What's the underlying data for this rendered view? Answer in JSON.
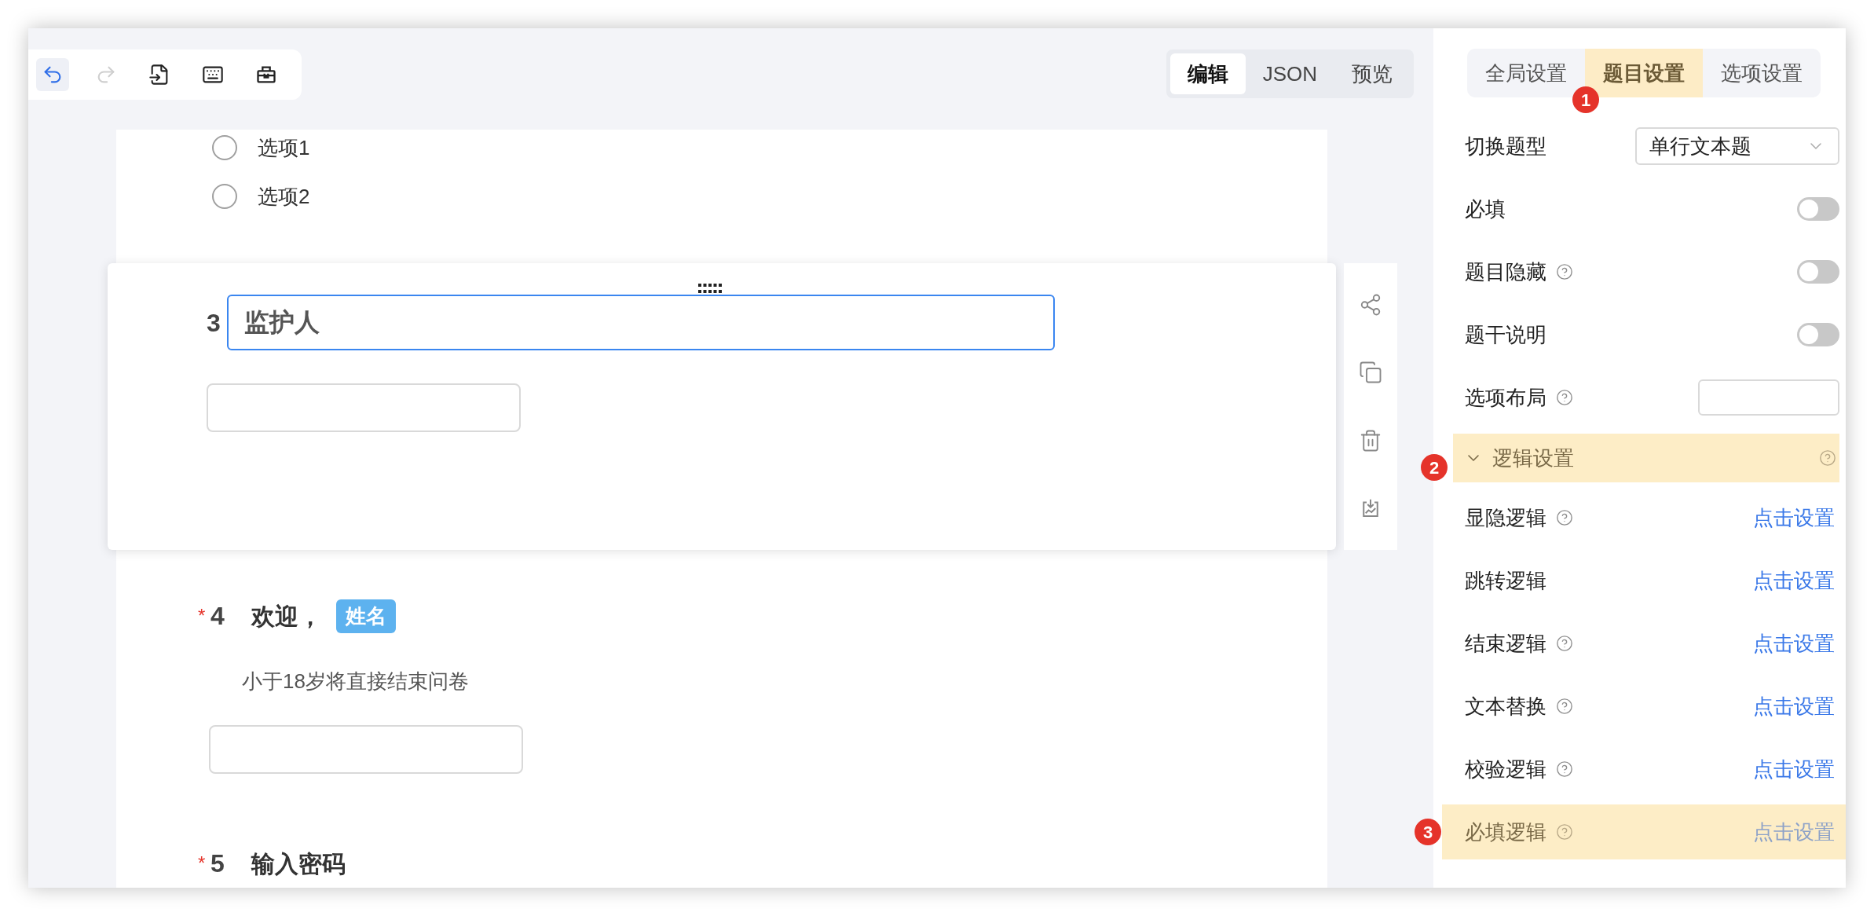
{
  "toolbar": {
    "buttons": [
      {
        "kind": "undo",
        "selected": true,
        "disabled": false
      },
      {
        "kind": "redo",
        "selected": false,
        "disabled": true
      },
      {
        "kind": "import",
        "selected": false,
        "disabled": false
      },
      {
        "kind": "keyboard",
        "selected": false,
        "disabled": false
      },
      {
        "kind": "toolbox",
        "selected": false,
        "disabled": false
      }
    ]
  },
  "mode_tabs": [
    {
      "label": "编辑",
      "selected": true
    },
    {
      "label": "JSON",
      "selected": false
    },
    {
      "label": "预览",
      "selected": false
    }
  ],
  "survey": {
    "options": [
      {
        "label": "选项1",
        "selected": false
      },
      {
        "label": "选项2",
        "selected": false
      }
    ],
    "questions": [
      {
        "number": "3",
        "title": "监护人",
        "active": true
      },
      {
        "number": "4",
        "title": "欢迎，",
        "tag": "姓名",
        "description": "小于18岁将直接结束问卷",
        "required_mark": "*",
        "active": false
      },
      {
        "number": "5",
        "title": "输入密码",
        "required_mark": "*",
        "active": false
      }
    ]
  },
  "settings_panel": {
    "tabs": [
      {
        "label": "全局设置",
        "selected": false,
        "highlighted": false
      },
      {
        "label": "题目设置",
        "selected": true,
        "highlighted": true,
        "marker": "1"
      },
      {
        "label": "选项设置",
        "selected": false,
        "highlighted": false
      }
    ],
    "rows": [
      {
        "kind": "select",
        "label": "切换题型",
        "help": false,
        "value": "单行文本题"
      },
      {
        "kind": "toggle",
        "label": "必填",
        "help": false,
        "on": false
      },
      {
        "kind": "toggle",
        "label": "题目隐藏",
        "help": true,
        "on": false
      },
      {
        "kind": "toggle",
        "label": "题干说明",
        "help": false,
        "on": false
      },
      {
        "kind": "input",
        "label": "选项布局",
        "help": true
      }
    ],
    "logic_section": {
      "title": "逻辑设置",
      "expanded": true,
      "highlighted": true,
      "marker": "2",
      "rows": [
        {
          "label": "显隐逻辑",
          "help": true,
          "action": "点击设置",
          "highlighted": false
        },
        {
          "label": "跳转逻辑",
          "help": false,
          "action": "点击设置",
          "highlighted": false
        },
        {
          "label": "结束逻辑",
          "help": true,
          "action": "点击设置",
          "highlighted": false
        },
        {
          "label": "文本替换",
          "help": true,
          "action": "点击设置",
          "highlighted": false
        },
        {
          "label": "校验逻辑",
          "help": true,
          "action": "点击设置",
          "highlighted": false
        },
        {
          "label": "必填逻辑",
          "help": true,
          "action": "点击设置",
          "highlighted": true,
          "marker": "3"
        }
      ]
    }
  }
}
